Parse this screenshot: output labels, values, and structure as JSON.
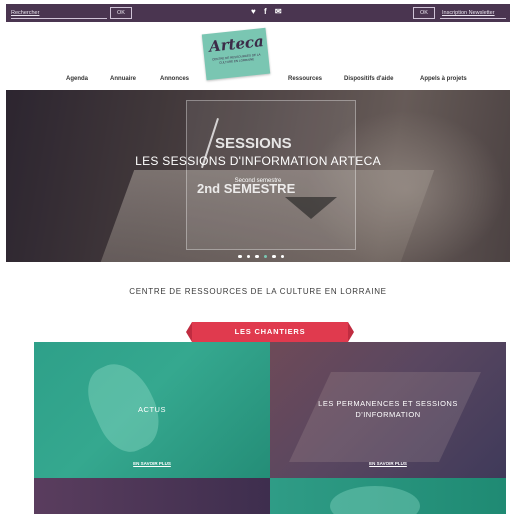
{
  "topbar": {
    "search_label": "Rechercher",
    "search_ok": "OK",
    "social": "♥ f ✉",
    "newsletter_ok": "OK",
    "newsletter_label": "Inscription Newsletter"
  },
  "logo": {
    "text": "Arteca",
    "tagline": "CENTRE DE RESSOURCES DE LA CULTURE EN LORRAINE"
  },
  "nav": {
    "items": [
      "Agenda",
      "Annuaire",
      "Annonces",
      "Ressources",
      "Dispositifs d'aide",
      "Appels à projets"
    ]
  },
  "hero": {
    "title": "LES SESSIONS D'INFORMATION ARTECA",
    "subtitle": "Second semestre",
    "poster_line1": "SESSIONS",
    "poster_line2": "2nd SEMESTRE",
    "slides": 6,
    "active_slide": 3
  },
  "headline": "CENTRE DE RESSOURCES DE LA CULTURE EN LORRAINE",
  "ribbon": "LES CHANTIERS",
  "tiles": [
    {
      "label": "ACTUS",
      "more": "EN SAVOIR PLUS"
    },
    {
      "label": "LES PERMANENCES ET SESSIONS D'INFORMATION",
      "more": "EN SAVOIR PLUS"
    }
  ],
  "colors": {
    "topbar": "#4a3550",
    "logo_bg": "#7ac6b2",
    "ribbon": "#e03a4e",
    "teal_tile": "#2ea089",
    "purple_tile": "#5a4760"
  }
}
